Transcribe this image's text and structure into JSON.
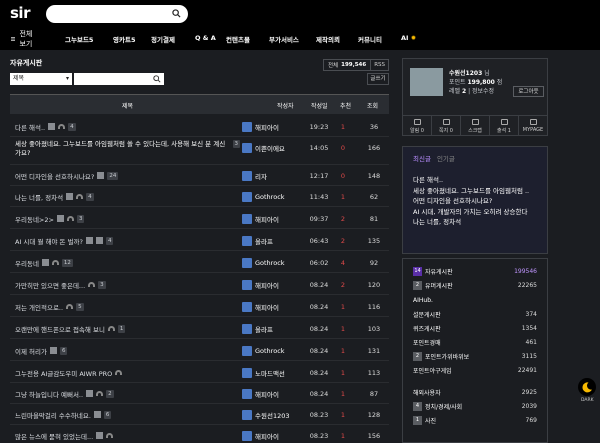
{
  "header": {
    "logo": "sir",
    "nav_menu_label": "전체보기",
    "nav": [
      "그누보드5",
      "영카트5",
      "정기결제",
      "Q & A",
      "컨텐츠몰",
      "부가서비스",
      "제작의뢰",
      "커뮤니티",
      "AI"
    ]
  },
  "board": {
    "title": "자유게시판",
    "total_label": "전체",
    "total_count": "199,546",
    "rss": "RSS",
    "search_field": "제목",
    "write_label": "글쓰기",
    "headers": {
      "title": "제목",
      "author": "작성자",
      "date": "작성일",
      "recommend": "추천",
      "views": "조회"
    },
    "rows": [
      {
        "title": "다른 해석..",
        "badges": [
          "img",
          "wifi"
        ],
        "count": "4",
        "author": "해피아이",
        "time": "19:23",
        "rec": "1",
        "views": "36"
      },
      {
        "title": "세상 좋아졌네요. 그누보드를 아임웹처럼 쓸 수 있다는데, 사용해 보신 분 계신가요?",
        "badges": [],
        "count": "3",
        "author": "이쁜이에요",
        "time": "14:05",
        "rec": "0",
        "views": "166",
        "multi": true
      },
      {
        "title": "어떤 디자인을 선호하시나요?",
        "badges": [
          "img"
        ],
        "count": "24",
        "author": "리자",
        "time": "12:17",
        "rec": "0",
        "views": "148"
      },
      {
        "title": "나는 너를, 정차석",
        "badges": [
          "img",
          "wifi"
        ],
        "count": "4",
        "author": "Gothrock",
        "time": "11:43",
        "rec": "1",
        "views": "62"
      },
      {
        "title": "우리동네>2>",
        "badges": [
          "img",
          "wifi"
        ],
        "count": "3",
        "author": "해피아이",
        "time": "09:37",
        "rec": "2",
        "views": "81"
      },
      {
        "title": "AI 시대 뭘 해야 돈 벌까?",
        "badges": [
          "img",
          "img"
        ],
        "count": "4",
        "author": "올라프",
        "time": "06:43",
        "rec": "2",
        "views": "135"
      },
      {
        "title": "우리동네",
        "badges": [
          "img",
          "wifi"
        ],
        "count": "12",
        "author": "Gothrock",
        "time": "06:02",
        "rec": "4",
        "views": "92"
      },
      {
        "title": "가만히만 있으면 좋은데...",
        "badges": [
          "wifi"
        ],
        "count": "3",
        "author": "해피아이",
        "time": "08.24",
        "rec": "2",
        "views": "120"
      },
      {
        "title": "저는 개인적으로..",
        "badges": [
          "wifi"
        ],
        "count": "5",
        "author": "해피아이",
        "time": "08.24",
        "rec": "1",
        "views": "116"
      },
      {
        "title": "오랜만에 핸드폰으로 접속해 보니",
        "badges": [
          "wifi"
        ],
        "count": "1",
        "author": "올라프",
        "time": "08.24",
        "rec": "1",
        "views": "103"
      },
      {
        "title": "이제 허리가",
        "badges": [
          "img"
        ],
        "count": "6",
        "author": "Gothrock",
        "time": "08.24",
        "rec": "1",
        "views": "131"
      },
      {
        "title": "그누전용 AI글감도우미 AIWR PRO",
        "badges": [
          "wifi"
        ],
        "count": "",
        "author": "노마드맥선",
        "time": "08.24",
        "rec": "1",
        "views": "113"
      },
      {
        "title": "그냥 하늘입니다 예뻐서..",
        "badges": [
          "img",
          "wifi"
        ],
        "count": "2",
        "author": "해피아이",
        "time": "08.24",
        "rec": "1",
        "views": "87"
      },
      {
        "title": "느린마을막걸리 수수하네요.",
        "badges": [
          "img"
        ],
        "count": "6",
        "author": "수원선1203",
        "time": "08.23",
        "rec": "1",
        "views": "128"
      },
      {
        "title": "많은 뉴스에 묻혀 있었는데...",
        "badges": [
          "img",
          "wifi"
        ],
        "count": "",
        "author": "해피아이",
        "time": "08.23",
        "rec": "1",
        "views": "156"
      }
    ]
  },
  "profile": {
    "name": "수원선1203",
    "name_suffix": "님",
    "points_label": "포인트",
    "points": "199,800",
    "points_unit": "점",
    "level_label": "레벨",
    "level": "2",
    "edit_label": "정보수정",
    "logout_label": "로그아웃",
    "menu": [
      "알림 0",
      "쪽지 0",
      "스크랩",
      "출석 1",
      "MYPAGE"
    ]
  },
  "latest": {
    "tab_active": "최신글",
    "tab_other": "인기글",
    "items": [
      "다른 해석..",
      "세상 좋아졌네요. 그누보드를 아임웹처럼 ..",
      "어떤 디자인을 선호하시나요?",
      "AI 시대, 개발자의 가치는 오히려 상승한다",
      "나는 너를, 정차석"
    ]
  },
  "boards": [
    {
      "badge": "14",
      "name": "자유게시판",
      "value": "199546",
      "purple": true
    },
    {
      "badge": "2",
      "name": "유머게시판",
      "value": "22265",
      "gray": true
    },
    {
      "badge": "",
      "name": "AIHub.",
      "value": ""
    },
    {
      "badge": "",
      "name": "설문게시판",
      "value": "374"
    },
    {
      "badge": "",
      "name": "퀴즈게시판",
      "value": "1354"
    },
    {
      "badge": "",
      "name": "포인트경매",
      "value": "461"
    },
    {
      "badge": "2",
      "name": "포인트가위바위보",
      "value": "3115",
      "gray": true
    },
    {
      "badge": "",
      "name": "포인트야구게임",
      "value": "22491"
    },
    {
      "badge": "",
      "name": "해외사용자",
      "value": "2925"
    },
    {
      "badge": "4",
      "name": "정치/경제/사회",
      "value": "2039",
      "gray": true
    },
    {
      "badge": "1",
      "name": "사진",
      "value": "769",
      "gray": true
    }
  ],
  "dark_label": "DARK"
}
